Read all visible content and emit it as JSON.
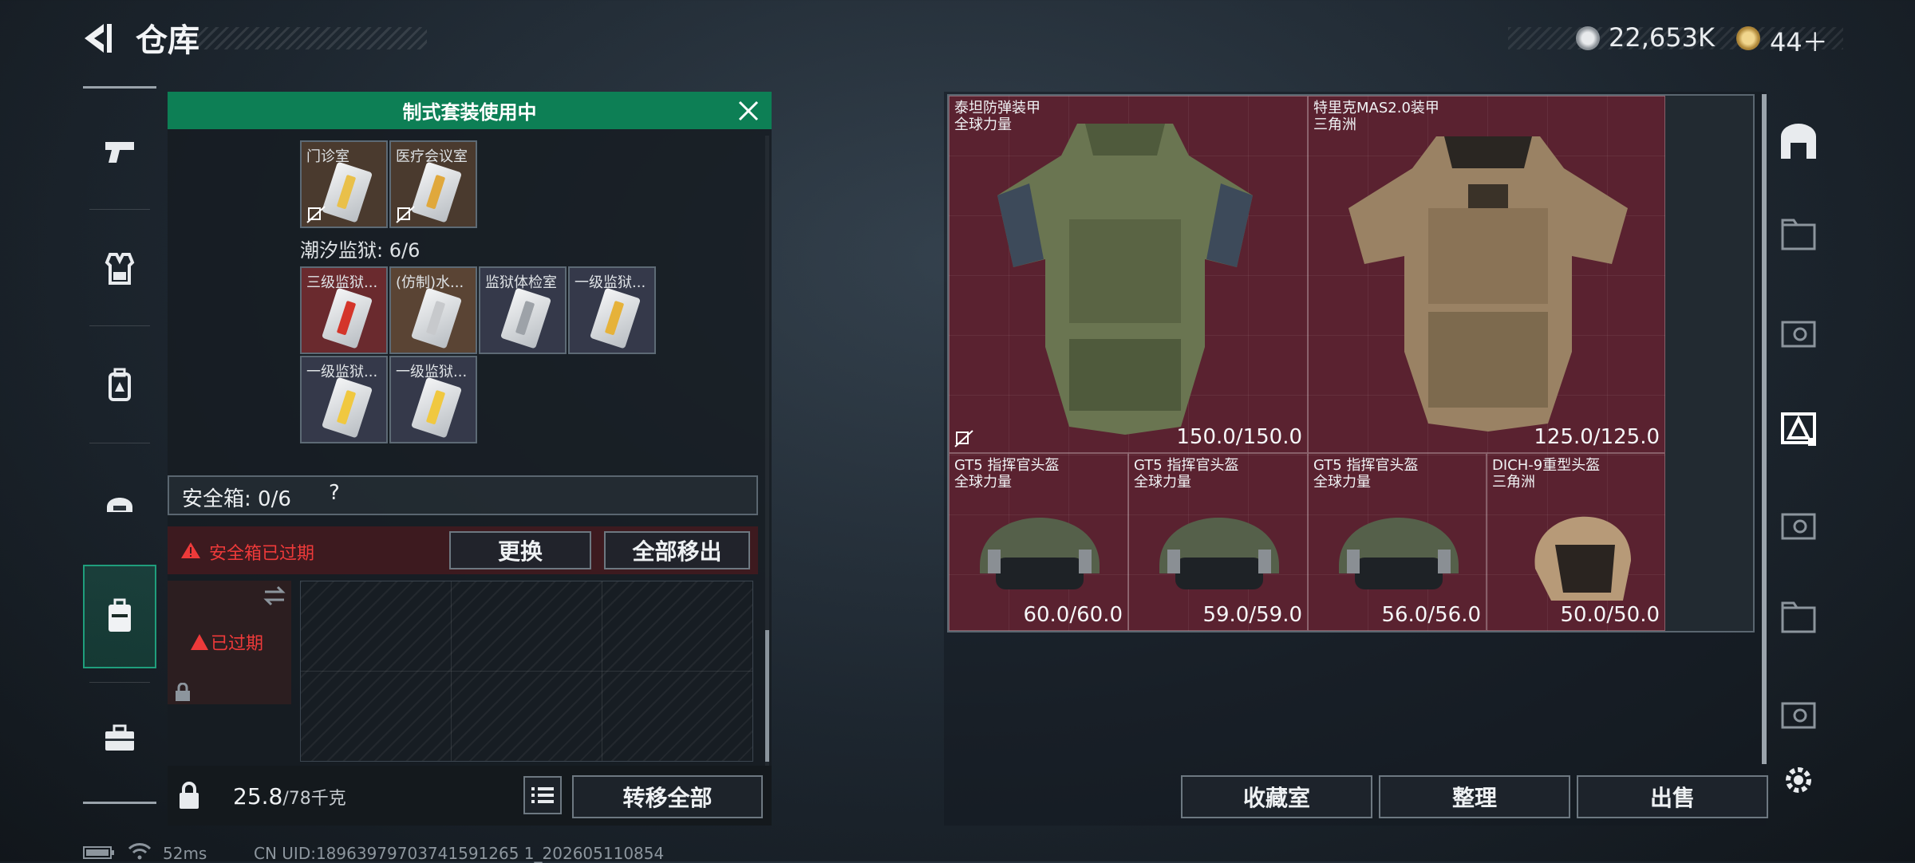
{
  "header": {
    "title": "仓库",
    "currency1_value": "22,653K",
    "currency2_value": "44＋"
  },
  "left_nav": {
    "items": [
      {
        "icon": "pistol-icon"
      },
      {
        "icon": "vest-icon"
      },
      {
        "icon": "backpack-icon"
      },
      {
        "icon": "helmet-icon"
      },
      {
        "icon": "safe-case-icon",
        "active": true
      },
      {
        "icon": "toolbox-icon"
      }
    ]
  },
  "loadout": {
    "banner": "制式套装使用中",
    "top_items": [
      {
        "label": "门诊室",
        "color": "#e9c04a"
      },
      {
        "label": "医疗会议室",
        "color": "#e0a83c"
      }
    ],
    "section_label": "潮汐监狱: 6/6",
    "prison_items": [
      {
        "label": "三级监狱...",
        "color": "#d4352a"
      },
      {
        "label": "(仿制)水...",
        "color": "#c7c9cc"
      },
      {
        "label": "监狱体检室",
        "color": "#9da2a8"
      },
      {
        "label": "一级监狱...",
        "color": "#e6b23a"
      },
      {
        "label": "一级监狱...",
        "color": "#f0c840"
      },
      {
        "label": "一级监狱...",
        "color": "#f0c840"
      }
    ],
    "safe_label": "安全箱: 0/6",
    "safe_help": "?",
    "expired_warning": "安全箱已过期",
    "replace_button": "更换",
    "remove_all_button": "全部移出",
    "safe_expired_badge": "已过期",
    "weight_value": "25.8",
    "weight_max": "/78千克",
    "transfer_all_button": "转移全部"
  },
  "stash": {
    "items": [
      {
        "name1": "泰坦防弹装甲",
        "name2": "全球力量",
        "durability": "150.0/150.0"
      },
      {
        "name1": "特里克MAS2.0装甲",
        "name2": "三角洲",
        "durability": "125.0/125.0"
      },
      {
        "name1": "GT5 指挥官头盔",
        "name2": "全球力量",
        "durability": "60.0/60.0"
      },
      {
        "name1": "GT5 指挥官头盔",
        "name2": "全球力量",
        "durability": "59.0/59.0"
      },
      {
        "name1": "GT5 指挥官头盔",
        "name2": "全球力量",
        "durability": "56.0/56.0"
      },
      {
        "name1": "DICH-9重型头盔",
        "name2": "三角洲",
        "durability": "50.0/50.0"
      }
    ],
    "collection_button": "收藏室",
    "sort_button": "整理",
    "sell_button": "出售"
  },
  "status_bar": {
    "ping": "52ms",
    "uid": "CN UID:18963979703741591265 1_202605110854"
  },
  "colors": {
    "banner_green": "#0d7f55",
    "warning_red": "#ee3a3a",
    "stash_red": "#5a2230"
  }
}
